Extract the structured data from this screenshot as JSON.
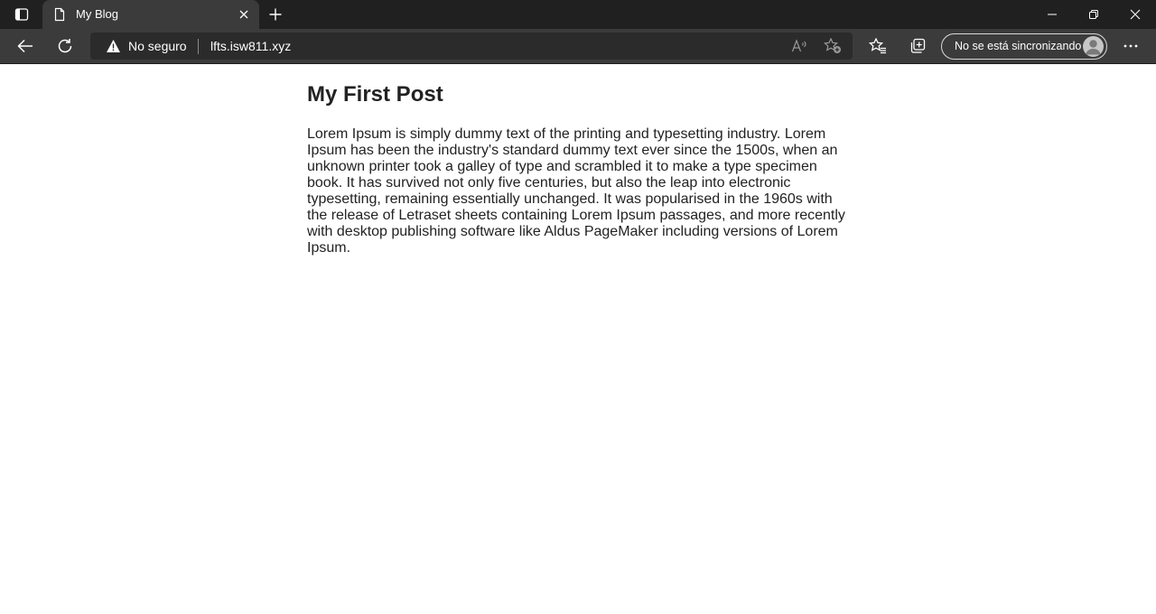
{
  "browser": {
    "tab": {
      "title": "My Blog"
    },
    "address_bar": {
      "security_label": "No seguro",
      "url": "lfts.isw811.xyz"
    },
    "profile": {
      "label": "No se está sincronizando"
    },
    "icons": {
      "tab_actions": "tab-actions-icon",
      "favicon": "page-icon",
      "tab_close": "close-icon",
      "new_tab": "plus-icon",
      "minimize": "minimize-icon",
      "restore": "restore-icon",
      "close": "close-icon",
      "back": "arrow-left-icon",
      "refresh": "refresh-icon",
      "warning": "warning-icon",
      "read_aloud": "read-aloud-icon",
      "add_favorite": "star-plus-icon",
      "favorites": "favorites-icon",
      "collections": "collections-icon",
      "more": "more-icon"
    },
    "colors": {
      "tabstrip": "#202020",
      "toolbar": "#3b3b3b",
      "addressbar": "#2b2b2b"
    }
  },
  "page": {
    "title": "My First Post",
    "body": "Lorem Ipsum is simply dummy text of the printing and typesetting industry. Lorem Ipsum has been the industry's standard dummy text ever since the 1500s, when an unknown printer took a galley of type and scrambled it to make a type specimen book. It has survived not only five centuries, but also the leap into electronic typesetting, remaining essentially unchanged. It was popularised in the 1960s with the release of Letraset sheets containing Lorem Ipsum passages, and more recently with desktop publishing software like Aldus PageMaker including versions of Lorem Ipsum."
  }
}
